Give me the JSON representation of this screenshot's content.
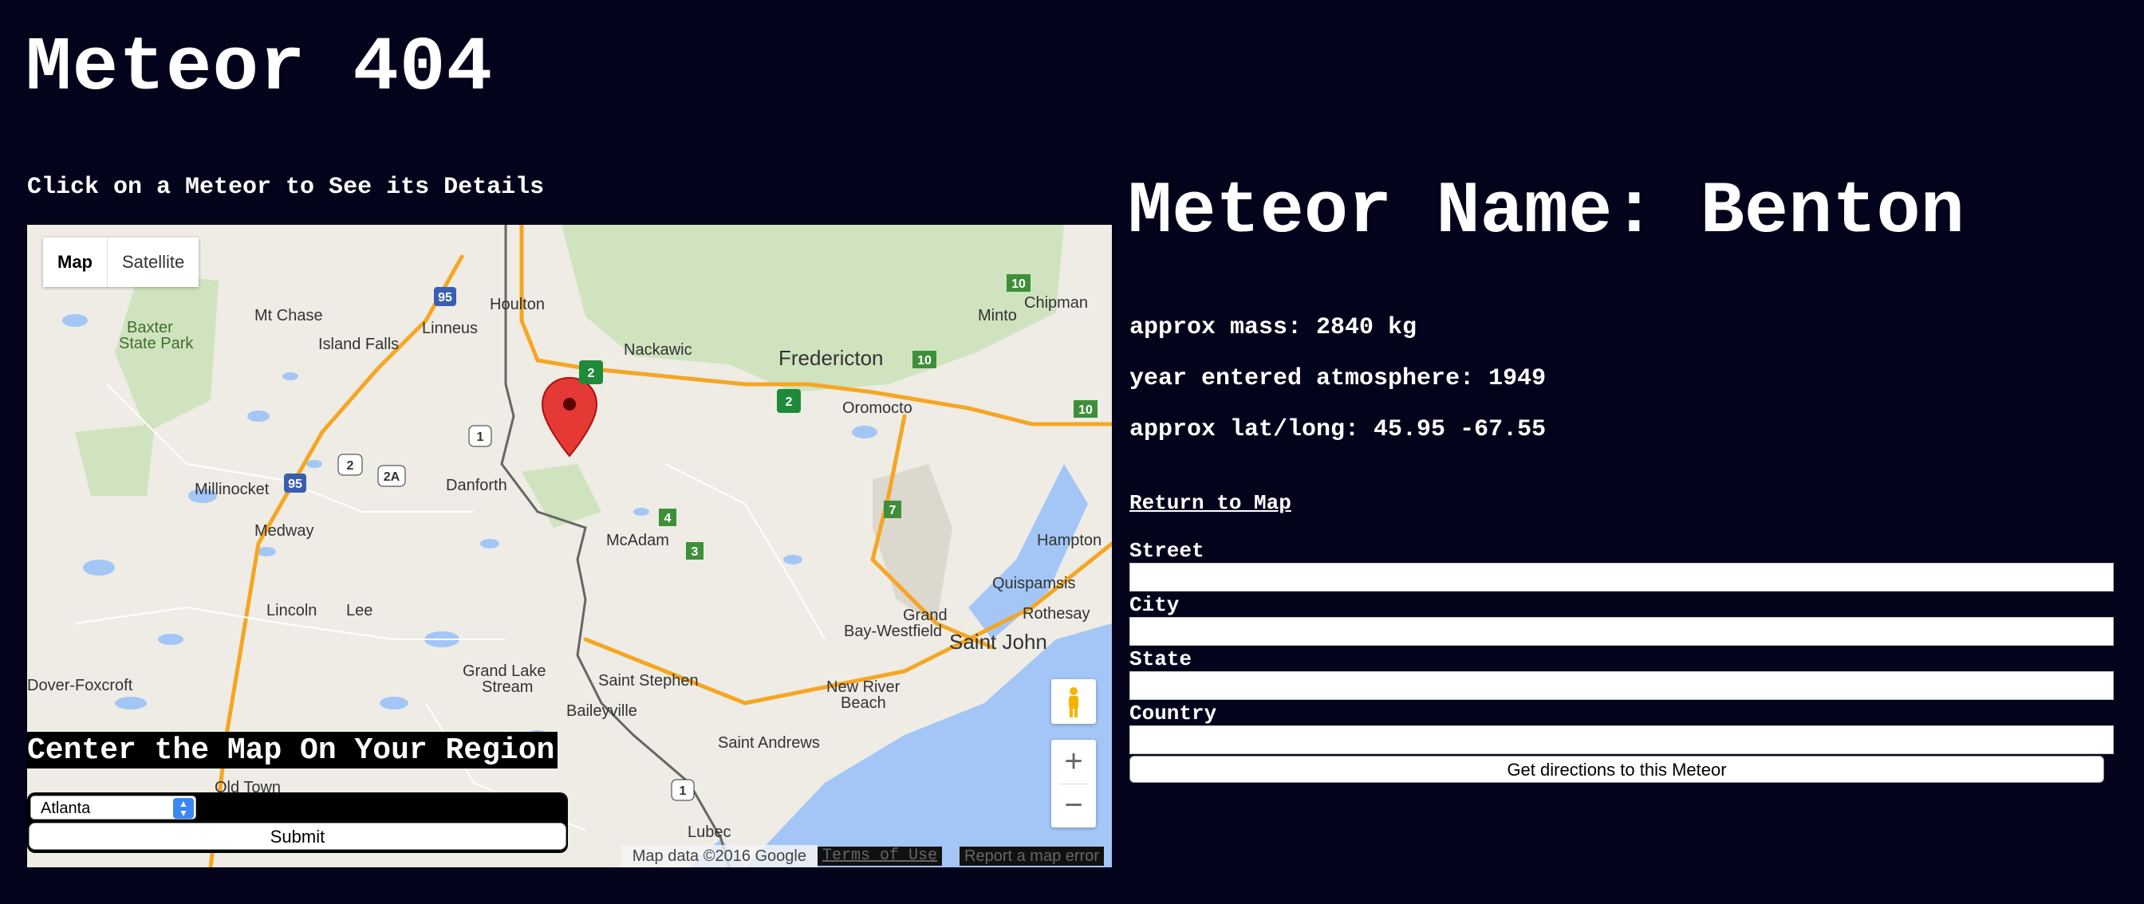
{
  "page": {
    "title": "Meteor 404",
    "map_instructions": "Click on a Meteor to See its Details"
  },
  "map": {
    "type_buttons": [
      "Map",
      "Satellite"
    ],
    "attribution": "Map data ©2016 Google",
    "terms": "Terms of Use",
    "report": "Report a map error",
    "zoom_in": "+",
    "zoom_out": "−",
    "labels": [
      "Houlton",
      "Mt Chase",
      "Baxter State Park",
      "Island Falls",
      "Linneus",
      "Nackawic",
      "Fredericton",
      "Oromocto",
      "Minto",
      "Chipman",
      "Millinocket",
      "Danforth",
      "Medway",
      "McAdam",
      "Hampton",
      "Quispamsis",
      "Rothesay",
      "Grand Bay-Westfield",
      "Saint John",
      "Lincoln",
      "Lee",
      "Dover-Foxcroft",
      "Grand Lake Stream",
      "Saint Stephen",
      "Baileyville",
      "New River Beach",
      "Saint Andrews",
      "Old Town",
      "Lubec"
    ],
    "route_shields": [
      "95",
      "95",
      "1",
      "2",
      "2A",
      "1",
      "2",
      "2",
      "10",
      "10",
      "10",
      "4",
      "3",
      "7"
    ]
  },
  "center_form": {
    "title": "Center the Map On Your Region",
    "selected_region": "Atlanta",
    "submit_label": "Submit"
  },
  "meteor": {
    "name_line": "Meteor Name: Benton",
    "mass_line": "approx mass: 2840 kg",
    "year_line": "year entered atmosphere: 1949",
    "latlong_line": "approx lat/long: 45.95 -67.55"
  },
  "directions": {
    "return_label": "Return to Map",
    "street_label": "Street",
    "city_label": "City",
    "state_label": "State",
    "country_label": "Country",
    "submit_label": "Get directions to this Meteor"
  },
  "colors": {
    "background": "#03041b",
    "text": "#ffffff",
    "map_land": "#eeece4",
    "map_water": "#a3c6f7",
    "map_park": "#cfe3bf",
    "map_highway": "#f5a623",
    "marker": "#e53935"
  }
}
